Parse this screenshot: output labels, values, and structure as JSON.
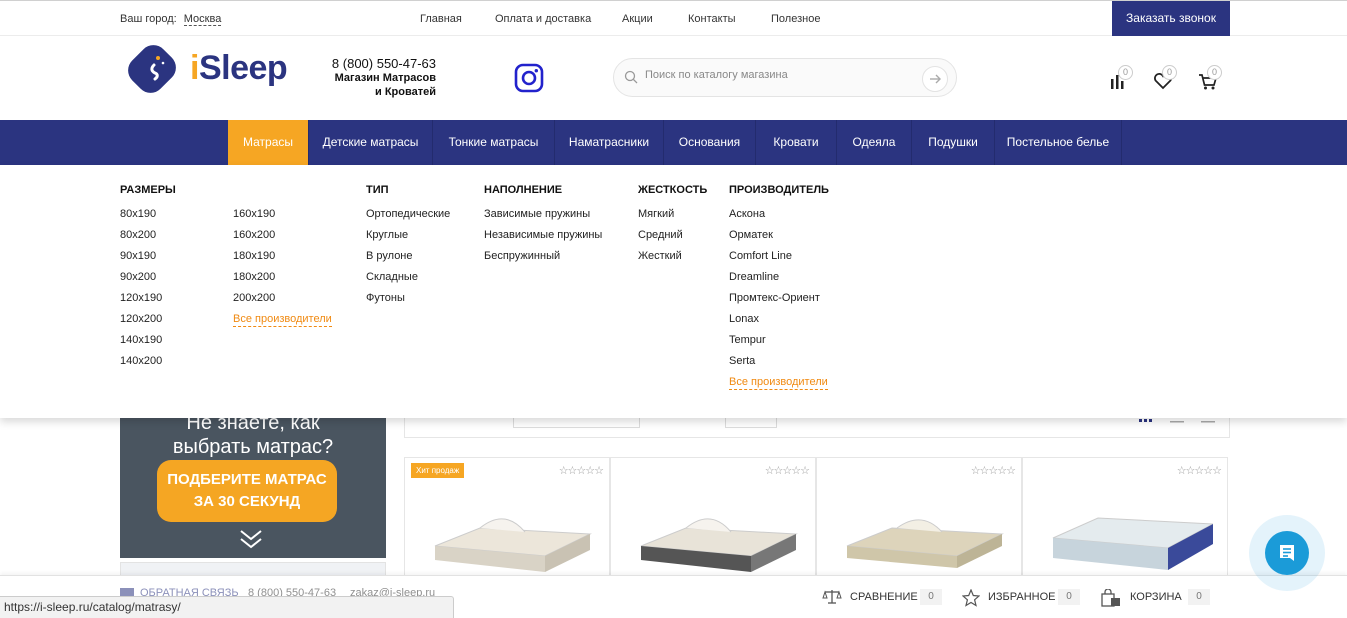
{
  "topbar": {
    "city_label": "Ваш город:",
    "city_value": "Москва",
    "nav": [
      "Главная",
      "Оплата и доставка",
      "Акции",
      "Контакты",
      "Полезное"
    ],
    "callback_button": "Заказать звонок"
  },
  "header": {
    "logo_text_i": "i",
    "logo_text_rest": "Sleep",
    "phone": "8 (800) 550-47-63",
    "store_line1": "Магазин Матрасов",
    "store_line2": "и Кроватей",
    "search_placeholder": "Поиск по каталогу магазина",
    "counts": {
      "compare": "0",
      "favorites": "0",
      "cart": "0"
    }
  },
  "mainnav": {
    "items": [
      "Матрасы",
      "Детские матрасы",
      "Тонкие матрасы",
      "Наматрасники",
      "Основания",
      "Кровати",
      "Одеяла",
      "Подушки",
      "Постельное белье"
    ],
    "active": "Матрасы"
  },
  "dropdown": {
    "sizes": {
      "title": "РАЗМЕРЫ",
      "col1": [
        "80x190",
        "80x200",
        "90x190",
        "90x200",
        "120x190",
        "120x200",
        "140x190",
        "140x200"
      ],
      "col2": [
        "160x190",
        "160x200",
        "180x190",
        "180x200",
        "200x200"
      ],
      "all_link": "Все производители"
    },
    "type": {
      "title": "ТИП",
      "items": [
        "Ортопедические",
        "Круглые",
        "В рулоне",
        "Складные",
        "Футоны"
      ]
    },
    "filling": {
      "title": "НАПОЛНЕНИЕ",
      "items": [
        "Зависимые пружины",
        "Независимые пружины",
        "Беспружинный"
      ]
    },
    "firmness": {
      "title": "ЖЕСТКОСТЬ",
      "items": [
        "Мягкий",
        "Средний",
        "Жесткий"
      ]
    },
    "manufacturer": {
      "title": "ПРОИЗВОДИТЕЛЬ",
      "items": [
        "Аскона",
        "Орматек",
        "Comfort Line",
        "Dreamline",
        "Промтекс-Ориент",
        "Lonax",
        "Tempur",
        "Serta"
      ],
      "all_link": "Все производители"
    }
  },
  "banner": {
    "line1": "Не знаете, как",
    "line2": "выбрать матрас?",
    "button_line1": "ПОДБЕРИТЕ МАТРАС",
    "button_line2": "ЗА 30 СЕКУНД"
  },
  "products": {
    "badge": "Хит продаж",
    "stars": "☆☆☆☆☆"
  },
  "bottombar": {
    "feedback": "ОБРАТНАЯ СВЯЗЬ",
    "phone": "8 (800) 550-47-63",
    "email": "zakaz@i-sleep.ru",
    "compare_label": "СРАВНЕНИЕ",
    "compare_count": "0",
    "favorites_label": "ИЗБРАННОЕ",
    "favorites_count": "0",
    "cart_label": "КОРЗИНА",
    "cart_count": "0"
  },
  "status_url": "https://i-sleep.ru/catalog/matrasy/",
  "colors": {
    "brand": "#2b3480",
    "accent": "#f6a623",
    "link": "#f08a12",
    "chat": "#1b9bd8"
  }
}
